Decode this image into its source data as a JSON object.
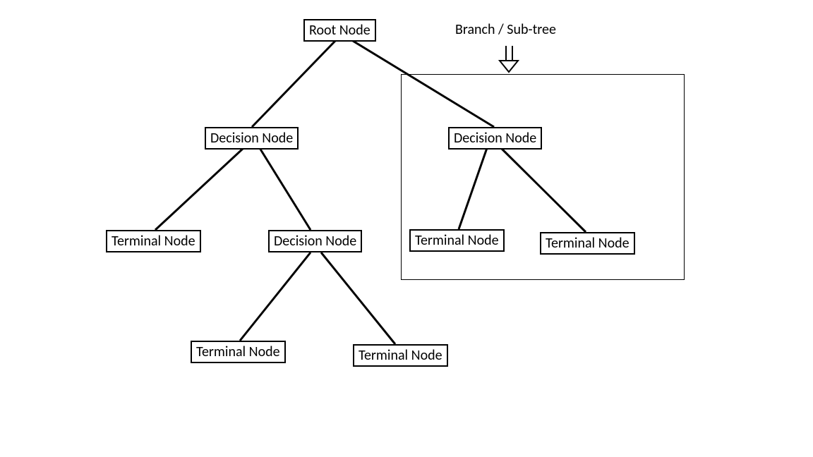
{
  "nodes": {
    "root": "Root Node",
    "dec_left": "Decision Node",
    "dec_right": "Decision Node",
    "term_ll": "Terminal Node",
    "dec_mid": "Decision Node",
    "term_rl": "Terminal Node",
    "term_rr": "Terminal Node",
    "term_ml": "Terminal Node",
    "term_mr": "Terminal Node"
  },
  "annotation": "Branch / Sub-tree"
}
